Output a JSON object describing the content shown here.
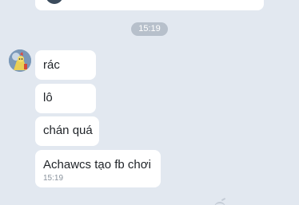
{
  "timestamp_pill": "15:19",
  "messages": [
    {
      "text": "rác"
    },
    {
      "text": "lô"
    },
    {
      "text": "chán quá"
    },
    {
      "text": "Achawcs tạo fb chơi",
      "time": "15:19"
    }
  ],
  "colors": {
    "background": "#e2e8f0",
    "bubble": "#ffffff",
    "time_pill": "#b7c0cb",
    "message_text": "#1f2328",
    "time_text": "#8a939d"
  },
  "icons": {
    "avatar": "avatar-icon"
  }
}
